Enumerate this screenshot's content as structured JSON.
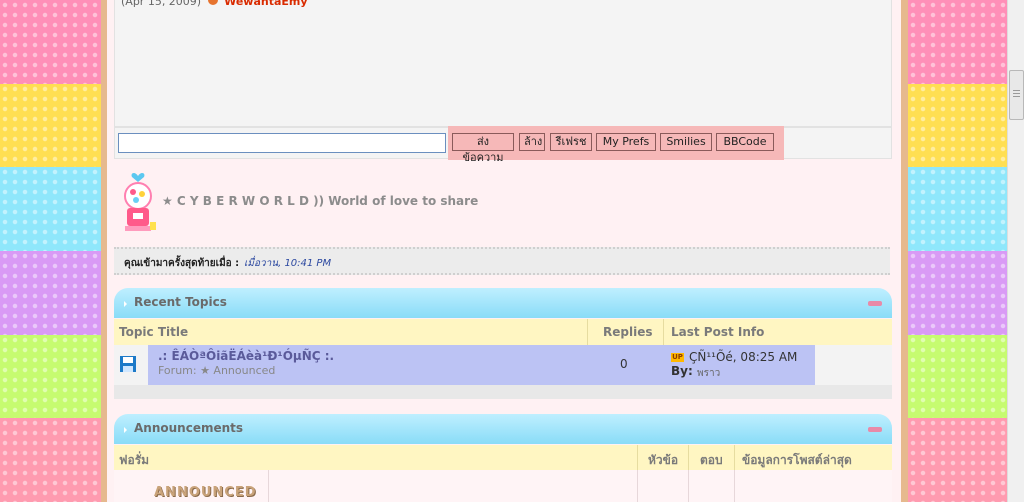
{
  "shoutbox": {
    "first_line_date": "(Apr 15, 2009)",
    "first_line_name": "WewantaEmy",
    "message_input_value": "",
    "buttons": {
      "send": "ส่งข้อความ",
      "clear": "ล้าง",
      "refresh": "รีเฟรช",
      "prefs": "My Prefs",
      "smilies": "Smilies",
      "bbcode": "BBCode"
    }
  },
  "site": {
    "title": "★ C Y B E R W O R L D )) World of love to share"
  },
  "last_visit": {
    "label": "คุณเข้ามาครั้งสุดท้ายเมื่อ :",
    "value": "เมื่อวาน, 10:41 PM"
  },
  "recent_topics": {
    "header": "Recent Topics",
    "columns": {
      "title": "Topic Title",
      "replies": "Replies",
      "last_post": "Last Post Info"
    },
    "rows": [
      {
        "title": ".: ÊÁÒªÔiãËÁèà¹Ð¹ÓµÑÇ :.",
        "forum": "Forum: ★ Announced",
        "replies": "0",
        "badge": "UP",
        "date": "ÇÑ¹¹Õé, 08:25 AM",
        "by_label": "By:",
        "author": "พราว"
      }
    ]
  },
  "announcements": {
    "header": "Announcements",
    "columns": {
      "forum": "ฟอรั่ม",
      "topics": "หัวข้อ",
      "replies": "ตอบ",
      "last_post": "ข้อมูลการโพสต์ล่าสุด"
    },
    "logo_text": "ANNOUNCED"
  },
  "colors": {
    "accent_blue": "#89dcf7",
    "header_yellow": "#fff6c2",
    "button_pink": "#f6b8b8",
    "highlight": "#bcc3f4"
  }
}
